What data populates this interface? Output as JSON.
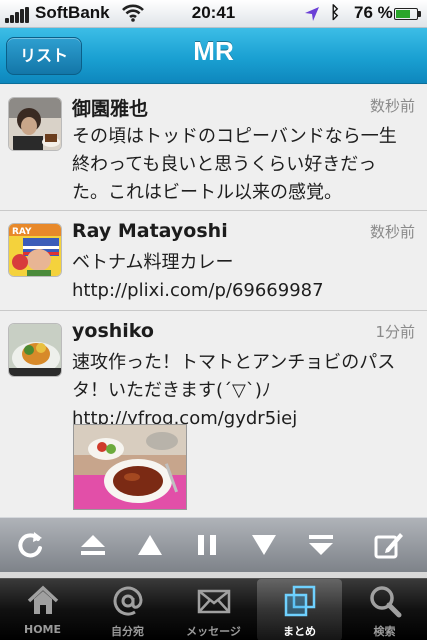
{
  "status_bar": {
    "carrier": "SoftBank",
    "time": "20:41",
    "battery_percent": "76 %",
    "battery_level": 0.76,
    "icons": [
      "signal-icon",
      "wifi-icon",
      "location-arrow-icon",
      "bluetooth-icon",
      "battery-icon"
    ]
  },
  "nav": {
    "back_label": "リスト",
    "title": "MR"
  },
  "tweets": [
    {
      "name": "御園雅也",
      "time": "数秒前",
      "text": "その頃はトッドのコピーバンドなら一生\n終わっても良いと思うくらい好きだっ\nた。これはビートル以来の感覚。"
    },
    {
      "name": "Ray Matayoshi",
      "time": "数秒前",
      "text": "ベトナム料理カレー\nhttp://plixi.com/p/69669987"
    },
    {
      "name": "yoshiko",
      "time": "1分前",
      "text": "速攻作った！トマトとアンチョビのパス\nタ！いただきます(´▽`)ﾉ\nhttp://yfrog.com/gydr5iej"
    }
  ],
  "toolbar": {
    "icons": [
      "refresh-icon",
      "scroll-to-top-icon",
      "page-up-icon",
      "pause-icon",
      "page-down-icon",
      "scroll-to-bottom-icon",
      "compose-icon"
    ]
  },
  "tabs": [
    {
      "label": "HOME",
      "icon": "home-icon"
    },
    {
      "label": "自分宛",
      "icon": "at-mention-icon"
    },
    {
      "label": "メッセージ",
      "icon": "envelope-icon"
    },
    {
      "label": "まとめ",
      "icon": "stacked-squares-icon",
      "active": true
    },
    {
      "label": "検索",
      "icon": "magnifier-icon"
    }
  ],
  "colors": {
    "nav_blue": "#1aa0d2",
    "tab_active": "#ffffff",
    "tab_inactive": "#9a9a9a",
    "timestamp": "#8a8a8a"
  }
}
